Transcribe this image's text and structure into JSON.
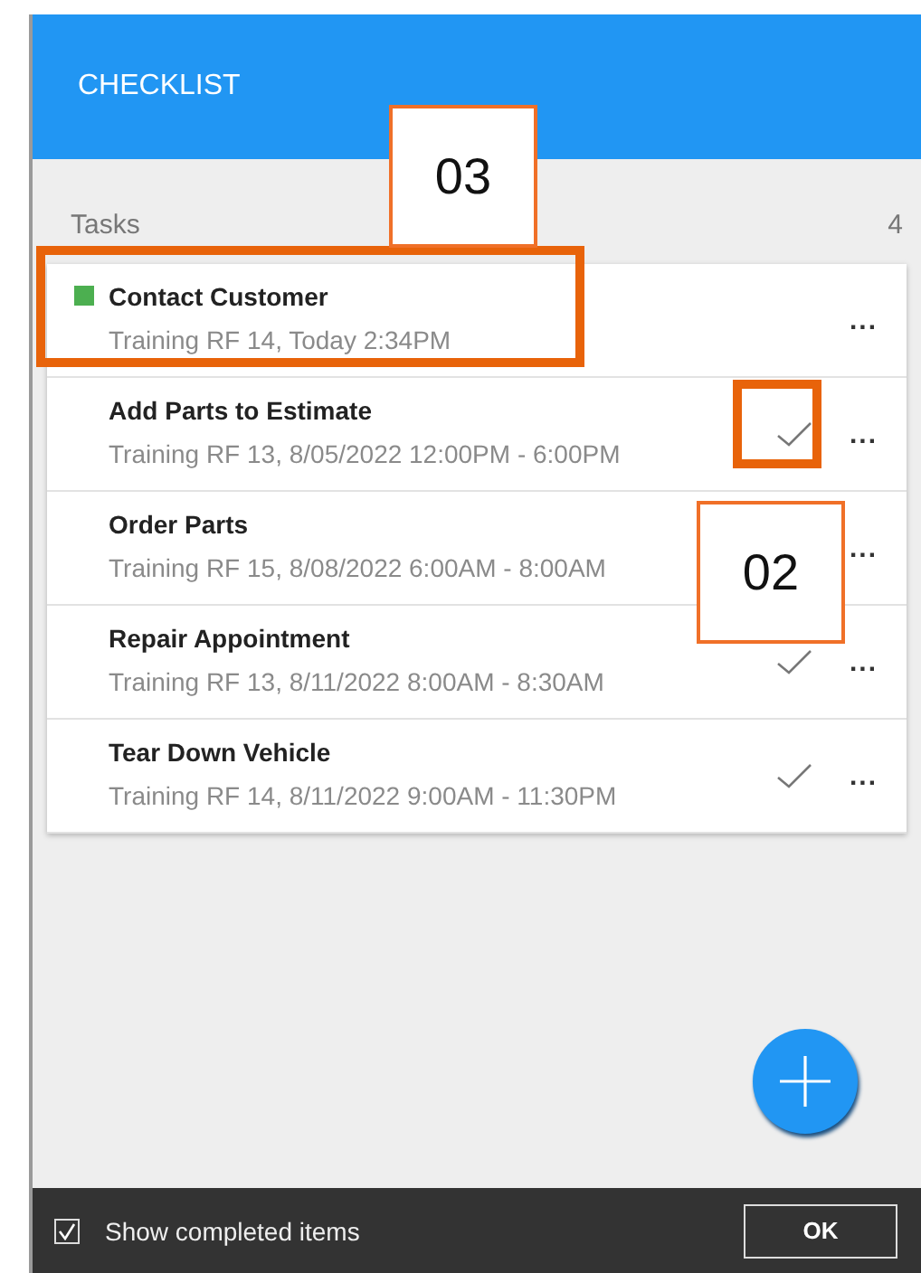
{
  "header": {
    "title": "CHECKLIST"
  },
  "section": {
    "label": "Tasks",
    "count": "4"
  },
  "tasks": [
    {
      "title": "Contact Customer",
      "detail": "Training RF 14, Today 2:34PM",
      "color": "#4caf50",
      "checkmark": false,
      "highlighted": true,
      "menu": "..."
    },
    {
      "title": "Add Parts to Estimate",
      "detail": "Training RF 13, 8/05/2022 12:00PM - 6:00PM",
      "checkmark": true,
      "highlighted": true,
      "menu": "..."
    },
    {
      "title": "Order Parts",
      "detail": "Training RF 15, 8/08/2022 6:00AM - 8:00AM",
      "checkmark": false,
      "highlighted": false,
      "menu": "..."
    },
    {
      "title": "Repair Appointment",
      "detail": "Training RF 13, 8/11/2022 8:00AM - 8:30AM",
      "checkmark": true,
      "highlighted": false,
      "menu": "..."
    },
    {
      "title": "Tear Down Vehicle",
      "detail": "Training RF 14, 8/11/2022 9:00AM - 11:30PM",
      "checkmark": true,
      "highlighted": false,
      "menu": "..."
    }
  ],
  "callouts": [
    {
      "label": "03"
    },
    {
      "label": "02"
    }
  ],
  "footer": {
    "show_completed": {
      "label": "Show completed items",
      "checked": true
    },
    "ok_button": "OK"
  }
}
